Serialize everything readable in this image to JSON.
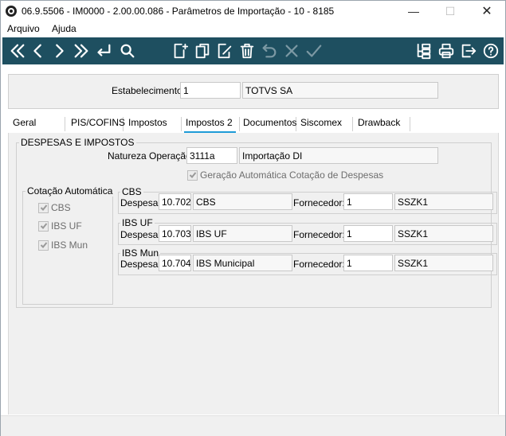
{
  "window": {
    "title": "06.9.5506 - IM0000 - 2.00.00.086 - Parâmetros de Importação - 10 - 8185",
    "min_glyph": "—",
    "max_glyph": "☐",
    "close_glyph": "✕"
  },
  "menu": [
    {
      "label": "Arquivo"
    },
    {
      "label": "Ajuda"
    }
  ],
  "toolbar": {
    "icons": [
      "first-record-icon",
      "previous-record-icon",
      "next-record-icon",
      "last-record-icon",
      "enter-icon",
      "search-icon",
      "new-document-icon",
      "copy-icon",
      "edit-icon",
      "delete-icon",
      "undo-icon",
      "cancel-icon",
      "confirm-icon",
      "tree-icon",
      "print-icon",
      "exit-icon",
      "help-icon"
    ]
  },
  "header": {
    "estabelecimento_label": "Estabelecimento:",
    "estabelecimento_code": "1",
    "estabelecimento_name": "TOTVS SA"
  },
  "tabs": [
    {
      "label": "Geral"
    },
    {
      "label": "PIS/COFINS"
    },
    {
      "label": "Impostos"
    },
    {
      "label": "Impostos 2",
      "active": true
    },
    {
      "label": "Documentos"
    },
    {
      "label": "Siscomex"
    },
    {
      "label": "Drawback"
    }
  ],
  "despesas": {
    "group_title": "DESPESAS E IMPOSTOS",
    "natureza_label": "Natureza Operação:",
    "natureza_code": "3111a",
    "natureza_desc": "Importação DI",
    "geracao_label": "Geração Automática Cotação de Despesas",
    "geracao_checked": true
  },
  "cotacao": {
    "title": "Cotação Automática",
    "items": [
      {
        "label": "CBS",
        "checked": true
      },
      {
        "label": "IBS UF",
        "checked": true
      },
      {
        "label": "IBS Mun",
        "checked": true
      }
    ]
  },
  "tax_groups": [
    {
      "title": "CBS",
      "despesa_label": "Despesa:",
      "despesa_code": "10.702",
      "despesa_desc": "CBS",
      "fornecedor_label": "Fornecedor:",
      "fornecedor_code": "1",
      "fornecedor_name": "SSZK1"
    },
    {
      "title": "IBS UF",
      "despesa_label": "Despesa:",
      "despesa_code": "10.703",
      "despesa_desc": "IBS UF",
      "fornecedor_label": "Fornecedor:",
      "fornecedor_code": "1",
      "fornecedor_name": "SSZK1"
    },
    {
      "title": "IBS Mun",
      "despesa_label": "Despesa:",
      "despesa_code": "10.704",
      "despesa_desc": "IBS Municipal",
      "fornecedor_label": "Fornecedor:",
      "fornecedor_code": "1",
      "fornecedor_name": "SSZK1"
    }
  ],
  "colors": {
    "toolbar_bg": "#1e4f60",
    "active_tab_underline": "#1e9bd7",
    "panel_bg": "#f0f0f0"
  }
}
